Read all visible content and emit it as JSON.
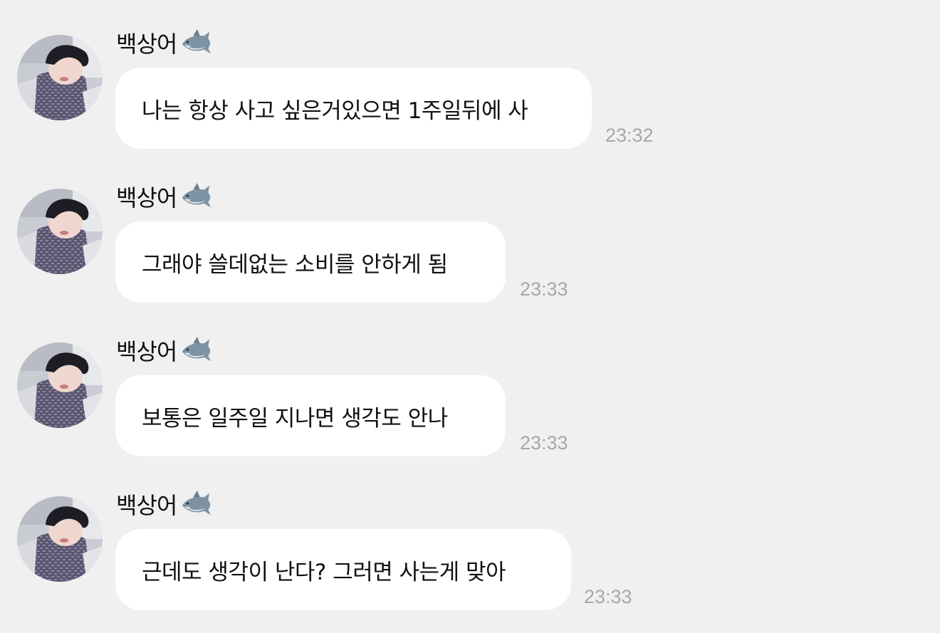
{
  "messages": [
    {
      "sender": "백상어",
      "text": "나는 항상 사고 싶은거있으면 1주일뒤에 사",
      "time": "23:32",
      "sender_icon": "shark-icon"
    },
    {
      "sender": "백상어",
      "text": "그래야 쓸데없는 소비를 안하게 됨",
      "time": "23:33",
      "sender_icon": "shark-icon"
    },
    {
      "sender": "백상어",
      "text": "보통은 일주일 지나면 생각도 안나",
      "time": "23:33",
      "sender_icon": "shark-icon"
    },
    {
      "sender": "백상어",
      "text": "근데도 생각이 난다? 그러면 사는게 맞아",
      "time": "23:33",
      "sender_icon": "shark-icon"
    }
  ],
  "colors": {
    "background": "#f0f0f0",
    "bubble": "#ffffff",
    "text": "#111111",
    "timestamp": "#a8a8a8"
  }
}
